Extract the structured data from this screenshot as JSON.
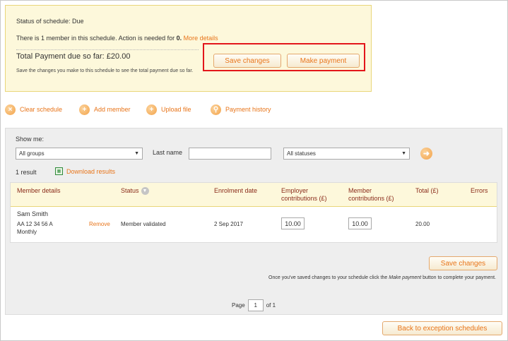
{
  "schedule": {
    "status_text": "Status of schedule: Due",
    "members_text_prefix": "There is 1 member in this schedule. Action is needed for ",
    "action_count": "0.",
    "more_details_label": "More details",
    "total_payment_text": "Total Payment due so far: £20.00",
    "hint_text": "Save the changes you make to this schedule to see the total payment due so far.",
    "save_changes_label": "Save changes",
    "make_payment_label": "Make payment",
    "highlight_color": "#e3161b"
  },
  "actions": {
    "clear_schedule": "Clear schedule",
    "add_member": "Add member",
    "upload_file": "Upload file",
    "payment_history": "Payment history"
  },
  "filters": {
    "show_me_label": "Show me:",
    "groups_selected": "All groups",
    "last_name_label": "Last name",
    "last_name_value": "",
    "statuses_selected": "All statuses"
  },
  "results": {
    "count_text": "1 result",
    "download_label": "Download results"
  },
  "table": {
    "headers": {
      "member_details": "Member details",
      "status": "Status",
      "enrolment_date": "Enrolment date",
      "employer_contributions": "Employer contributions (£)",
      "member_contributions": "Member contributions (£)",
      "total": "Total (£)",
      "errors": "Errors"
    },
    "rows": [
      {
        "name": "Sam Smith",
        "ni_number": "AA 12 34 56 A",
        "frequency": "Monthly",
        "remove_label": "Remove",
        "status": "Member validated",
        "enrolment_date": "2 Sep 2017",
        "employer_contribution": "10.00",
        "member_contribution": "10.00",
        "total": "20.00",
        "errors": ""
      }
    ]
  },
  "footer": {
    "save_changes_label": "Save changes",
    "note_prefix": "Once you've saved changes to your schedule click the ",
    "note_emphasis": "Make payment",
    "note_suffix": " button to complete your payment.",
    "page_label": "Page",
    "page_value": "1",
    "page_of": "of 1",
    "back_label": "Back to exception schedules"
  },
  "colors": {
    "accent": "#e8751a",
    "status_bg": "#fdf8db",
    "panel_bg": "#eeeeee",
    "header_text": "#8a2b1a"
  },
  "icons": {
    "clear": "close-circle-icon",
    "add": "plus-circle-icon",
    "upload": "upload-circle-icon",
    "history": "magnifier-circle-icon",
    "go": "arrow-right-circle-icon",
    "download": "spreadsheet-icon",
    "sort": "chevron-down-icon"
  }
}
